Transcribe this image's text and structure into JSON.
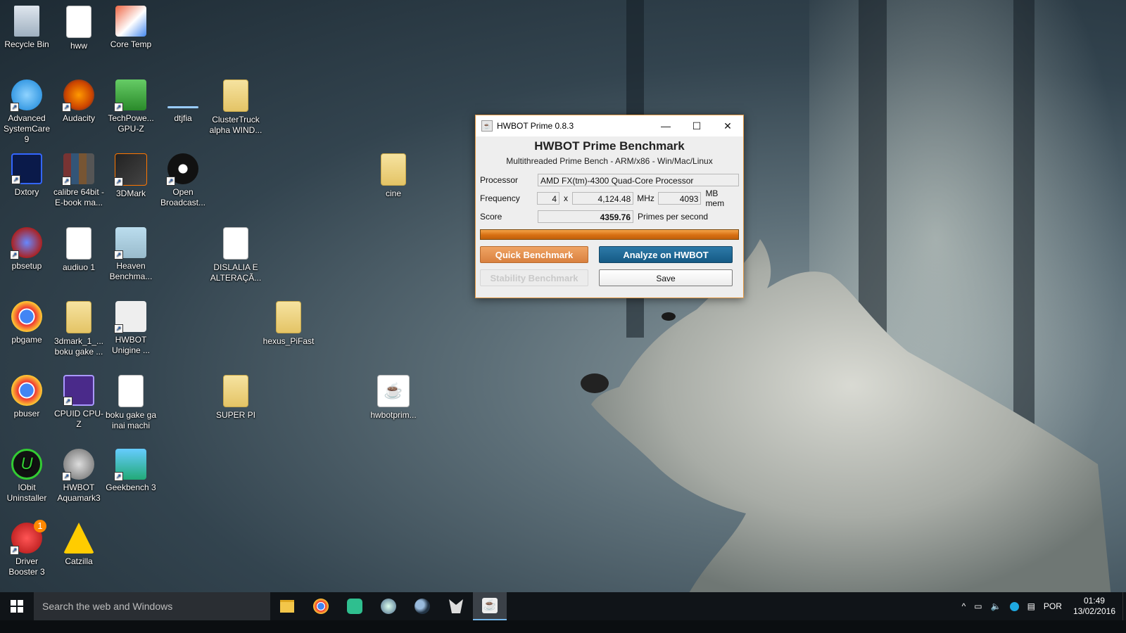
{
  "desktop": {
    "icons": [
      {
        "label": "Recycle Bin"
      },
      {
        "label": "hww"
      },
      {
        "label": "Core Temp"
      },
      {
        "label": "Advanced SystemCare 9"
      },
      {
        "label": "Audacity"
      },
      {
        "label": "TechPowe... GPU-Z"
      },
      {
        "label": "dtjfia"
      },
      {
        "label": "ClusterTruck alpha WIND..."
      },
      {
        "label": "Dxtory"
      },
      {
        "label": "calibre 64bit - E-book ma..."
      },
      {
        "label": "3DMark"
      },
      {
        "label": "Open Broadcast..."
      },
      {
        "label": "cine"
      },
      {
        "label": "pbsetup"
      },
      {
        "label": "audiuo 1"
      },
      {
        "label": "Heaven Benchma..."
      },
      {
        "label": "DISLALIA E ALTERAÇÃ..."
      },
      {
        "label": "pbgame"
      },
      {
        "label": "3dmark_1_... boku gake ..."
      },
      {
        "label": "HWBOT Unigine ..."
      },
      {
        "label": "hexus_PiFast"
      },
      {
        "label": "pbuser"
      },
      {
        "label": "CPUID CPU-Z"
      },
      {
        "label": "boku gake ga inai machi"
      },
      {
        "label": "SUPER PI"
      },
      {
        "label": "hwbotprim..."
      },
      {
        "label": "IObit Uninstaller"
      },
      {
        "label": "HWBOT Aquamark3"
      },
      {
        "label": "Geekbench 3"
      },
      {
        "label": "Driver Booster 3"
      },
      {
        "label": "Catzilla"
      }
    ],
    "driver_booster_badge": "1"
  },
  "window": {
    "title": "HWBOT Prime 0.8.3",
    "heading": "HWBOT Prime Benchmark",
    "subheading": "Multithreaded Prime Bench - ARM/x86 - Win/Mac/Linux",
    "processor_label": "Processor",
    "processor_value": "AMD FX(tm)-4300 Quad-Core Processor",
    "frequency_label": "Frequency",
    "cores": "4",
    "times_sign": "x",
    "mhz_value": "4,124.48",
    "mhz_unit": "MHz",
    "mem_value": "4093",
    "mem_unit": "MB mem",
    "score_label": "Score",
    "score_value": "4359.76",
    "score_unit": "Primes per second",
    "progress_fraction": 1.0,
    "buttons": {
      "quick": "Quick Benchmark",
      "analyze": "Analyze on HWBOT",
      "stability": "Stability Benchmark",
      "save": "Save"
    }
  },
  "taskbar": {
    "search_placeholder": "Search the web and Windows",
    "language": "POR",
    "time": "01:49",
    "date": "13/02/2016"
  },
  "colors": {
    "accent_orange": "#d9813f",
    "accent_blue": "#155a85",
    "taskbar": "#101418"
  }
}
